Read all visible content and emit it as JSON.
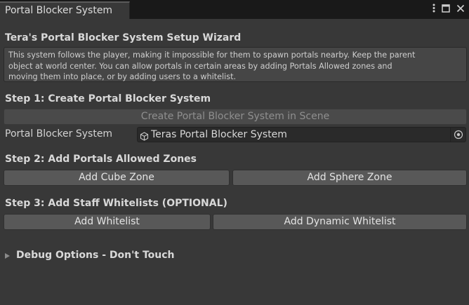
{
  "window": {
    "tab_title": "Portal Blocker System",
    "icons": [
      "more-vert-icon",
      "maximize-icon",
      "close-icon"
    ]
  },
  "wizard": {
    "title": "Tera's Portal Blocker System Setup Wizard",
    "help_line1": "This system follows the player, making it impossible for them to spawn portals nearby. Keep the parent",
    "help_line2": "object at world center. You can allow portals in certain areas by adding Portals Allowed zones and",
    "help_line3": "moving them into place, or by adding users to a whitelist."
  },
  "step1": {
    "heading": "Step 1: Create Portal Blocker System",
    "create_button": "Create Portal Blocker System in Scene",
    "field_label": "Portal Blocker System",
    "field_value": "Teras Portal Blocker System",
    "field_icon": "gameobject-cube-icon"
  },
  "step2": {
    "heading": "Step 2: Add Portals Allowed Zones",
    "cube_button": "Add Cube Zone",
    "sphere_button": "Add Sphere Zone"
  },
  "step3": {
    "heading": "Step 3: Add Staff Whitelists (OPTIONAL)",
    "whitelist_button": "Add Whitelist",
    "dynamic_button": "Add Dynamic Whitelist"
  },
  "debug": {
    "label": "Debug Options - Don't Touch",
    "expanded": false
  },
  "colors": {
    "background": "#383838",
    "titlebar": "#191919",
    "button": "#585858",
    "field": "#2a2a2a"
  }
}
